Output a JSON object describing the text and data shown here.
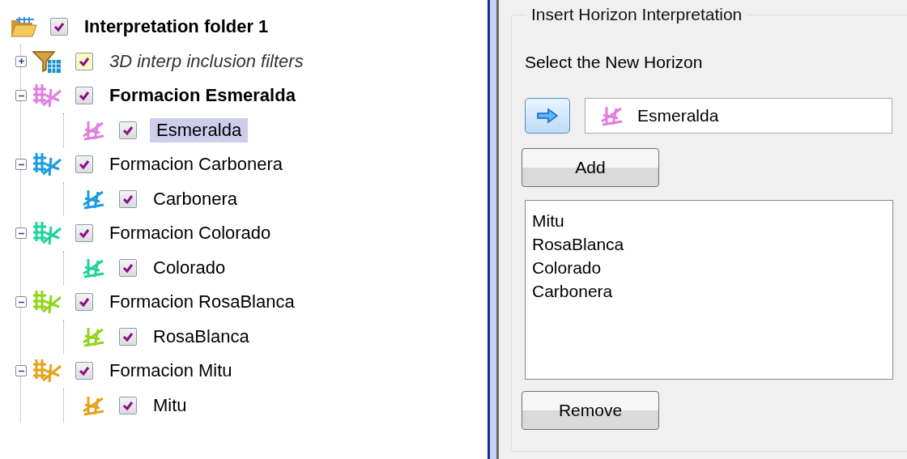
{
  "tree": {
    "label": "Interpretation folder 1",
    "checked": true,
    "children": [
      {
        "kind": "filter",
        "label": "3D interp inclusion filters",
        "checked": true,
        "expanded": false,
        "active": false
      },
      {
        "kind": "formation",
        "label": "Formacion Esmeralda",
        "checked": true,
        "expanded": true,
        "active": true,
        "color": "#e07ee0",
        "children": [
          {
            "label": "Esmeralda",
            "checked": true,
            "selected": true,
            "color": "#e07ee0"
          }
        ]
      },
      {
        "kind": "formation",
        "label": "Formacion Carbonera",
        "checked": true,
        "expanded": true,
        "active": false,
        "color": "#1a9be0",
        "children": [
          {
            "label": "Carbonera",
            "checked": true,
            "selected": false,
            "color": "#1a9be0"
          }
        ]
      },
      {
        "kind": "formation",
        "label": "Formacion Colorado",
        "checked": true,
        "expanded": true,
        "active": false,
        "color": "#1fd39a",
        "children": [
          {
            "label": "Colorado",
            "checked": true,
            "selected": false,
            "color": "#1fd39a"
          }
        ]
      },
      {
        "kind": "formation",
        "label": "Formacion RosaBlanca",
        "checked": true,
        "expanded": true,
        "active": false,
        "color": "#8fd61a",
        "children": [
          {
            "label": "RosaBlanca",
            "checked": true,
            "selected": false,
            "color": "#8fd61a"
          }
        ]
      },
      {
        "kind": "formation",
        "label": "Formacion Mitu",
        "checked": true,
        "expanded": true,
        "active": false,
        "color": "#e8a21a",
        "children": [
          {
            "label": "Mitu",
            "checked": true,
            "selected": false,
            "color": "#e8a21a"
          }
        ]
      }
    ]
  },
  "panel": {
    "title": "Insert Horizon Interpretation",
    "prompt": "Select the New Horizon",
    "horizon_field": {
      "value": "Esmeralda",
      "color": "#e07ee0"
    },
    "add_button": "Add",
    "list": [
      "Mitu",
      "RosaBlanca",
      "Colorado",
      "Carbonera"
    ],
    "remove_button": "Remove"
  }
}
